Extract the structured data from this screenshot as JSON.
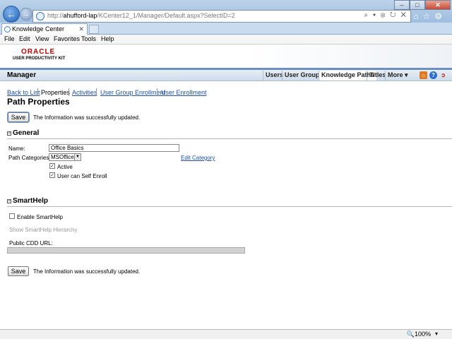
{
  "browser": {
    "url_prefix": "http://",
    "url_host": "ahufford-lap",
    "url_path": "/KCenter12_1/Manager/Default.aspx?SelectID=2",
    "address_tools": "⌕ ▾ ⊗ ↻ ✕",
    "tab_title": "Knowledge Center",
    "menu": [
      "File",
      "Edit",
      "View",
      "Favorites",
      "Tools",
      "Help"
    ],
    "zoom": "🔍100%",
    "zoom_caret": "▾"
  },
  "header": {
    "brand": "ORACLE",
    "product": "USER PRODUCTIVITY KIT",
    "section": "Manager",
    "tabs": [
      "Users",
      "User Groups",
      "Knowledge Paths",
      "Titles",
      "More ▾"
    ],
    "active_tab": "Knowledge Paths"
  },
  "subnav": {
    "back": "Back to List",
    "properties": "Properties",
    "activities": "Activities",
    "group_enrollment": "User Group Enrollment",
    "user_enrollment": "User Enrollment"
  },
  "page": {
    "title": "Path Properties",
    "save_label": "Save",
    "message": "The Information was successfully updated."
  },
  "general": {
    "heading": "General",
    "collapse_symbol": "−",
    "name_label": "Name:",
    "name_value": "Office Basics",
    "categories_label": "Path Categories:",
    "category_value": "MSOffice",
    "edit_category": "Edit Category",
    "active_label": "Active",
    "active_checked": true,
    "self_enroll_label": "User can Self Enroll",
    "self_enroll_checked": true
  },
  "smarthelp": {
    "heading": "SmartHelp",
    "enable_label": "Enable SmartHelp",
    "enable_checked": false,
    "hierarchy_link": "Show SmartHelp Hierarchy",
    "cdd_label": "Public CDD URL:",
    "cdd_value": ""
  },
  "colors": {
    "link": "#1f4fa8",
    "brand_red": "#cc0000",
    "header_stripe": "#6b8fc0"
  }
}
